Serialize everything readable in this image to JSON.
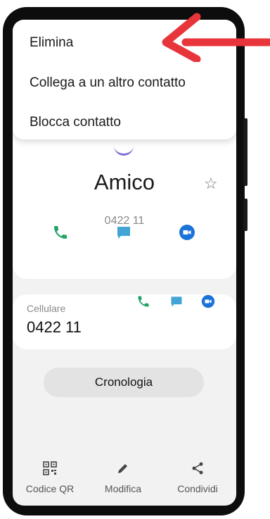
{
  "menu": {
    "items": [
      {
        "label": "Elimina"
      },
      {
        "label": "Collega a un altro contatto"
      },
      {
        "label": "Blocca contatto"
      }
    ]
  },
  "contact": {
    "name": "Amico",
    "number": "0422 11"
  },
  "phone_entry": {
    "label": "Cellulare",
    "number": "0422 11"
  },
  "history_button": "Cronologia",
  "toolbar": {
    "qr_label": "Codice QR",
    "edit_label": "Modifica",
    "share_label": "Condividi"
  },
  "icons": {
    "call": "phone-icon",
    "message": "message-icon",
    "video": "video-call-icon",
    "favorite": "star-icon",
    "qr": "qr-code-icon",
    "edit": "pencil-icon",
    "share": "share-icon",
    "nav_recents": "recents-icon",
    "nav_home": "home-icon",
    "nav_back": "back-icon"
  },
  "colors": {
    "call": "#1fa463",
    "message": "#42a5d6",
    "video": "#1a73d9",
    "annotation_arrow": "#e8343b"
  }
}
